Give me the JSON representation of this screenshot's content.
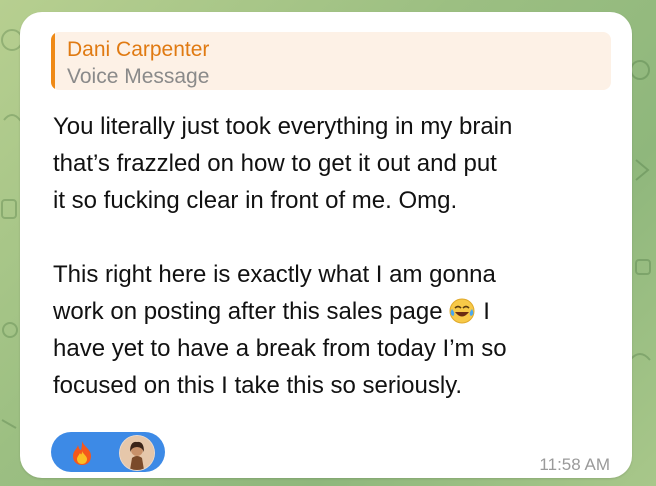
{
  "reply": {
    "sender": "Dani Carpenter",
    "type_label": "Voice Message"
  },
  "message": {
    "lines_p1": [
      "You literally just took everything in my brain",
      "that’s frazzled on how to get it out and put",
      "it so fucking clear in front of me. Omg."
    ],
    "lines_p2_a": "This right here is exactly what I am gonna",
    "lines_p2_b_before": "work on posting after this sales page",
    "lines_p2_b_after": "I",
    "lines_p2_c": "have yet to have a break from today I’m so",
    "lines_p2_d": "focused on this I take this so seriously.",
    "inline_emoji": "tears-of-joy-emoji"
  },
  "reactions": {
    "items": [
      "fire-emoji",
      "user-avatar"
    ]
  },
  "timestamp": "11:58 AM",
  "colors": {
    "accent": "#ef8a17",
    "reaction_bg": "#3d8ae6",
    "bubble": "#ffffff"
  }
}
